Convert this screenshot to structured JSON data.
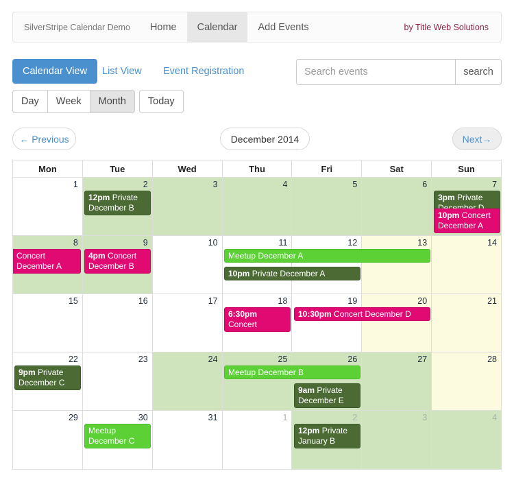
{
  "navbar": {
    "brand": "SilverStripe Calendar Demo",
    "links": [
      {
        "label": "Home",
        "active": false
      },
      {
        "label": "Calendar",
        "active": true
      },
      {
        "label": "Add Events",
        "active": false
      }
    ],
    "credit": "by Title Web Solutions"
  },
  "views": {
    "primary": "Calendar View",
    "list_view": "List View",
    "event_registration": "Event Registration"
  },
  "search": {
    "placeholder": "Search events",
    "value": "",
    "button": "search"
  },
  "ranges": [
    {
      "label": "Day",
      "active": false
    },
    {
      "label": "Week",
      "active": false
    },
    {
      "label": "Month",
      "active": true
    },
    {
      "label": "Today",
      "active": false
    }
  ],
  "pager": {
    "previous": "← Previous",
    "title": "December 2014",
    "next": "Next→"
  },
  "colors": {
    "private": "#4c6b34",
    "concert": "#e00a72",
    "meetup": "#5bd136",
    "accent": "#4a90cf",
    "tint_green": "#cfe4bd",
    "tint_cream": "#fcfadf",
    "brand_credit": "#8d2241"
  },
  "calendar": {
    "weekdays": [
      "Mon",
      "Tue",
      "Wed",
      "Thu",
      "Fri",
      "Sat",
      "Sun"
    ],
    "weeks": [
      {
        "days": [
          {
            "num": "1",
            "tint": "none",
            "other": false
          },
          {
            "num": "2",
            "tint": "green",
            "other": false
          },
          {
            "num": "3",
            "tint": "green",
            "other": false
          },
          {
            "num": "4",
            "tint": "green",
            "other": false
          },
          {
            "num": "5",
            "tint": "green",
            "other": false
          },
          {
            "num": "6",
            "tint": "green",
            "other": false
          },
          {
            "num": "7",
            "tint": "green",
            "other": false
          }
        ],
        "events": [
          {
            "time": "12pm",
            "title": "Private December B",
            "kind": "private",
            "col": 1,
            "span": 1,
            "row": 0,
            "lines": 2
          },
          {
            "time": "3pm",
            "title": "Private December D",
            "kind": "private",
            "col": 6,
            "span": 1,
            "row": 0,
            "lines": 2
          },
          {
            "time": "10pm",
            "title": "Concert December A",
            "kind": "concert",
            "col": 6,
            "span": 1,
            "row": 1,
            "lines": 2
          }
        ]
      },
      {
        "days": [
          {
            "num": "8",
            "tint": "green",
            "other": false
          },
          {
            "num": "9",
            "tint": "green",
            "other": false
          },
          {
            "num": "10",
            "tint": "none",
            "other": false
          },
          {
            "num": "11",
            "tint": "none",
            "other": false
          },
          {
            "num": "12",
            "tint": "none",
            "other": false
          },
          {
            "num": "13",
            "tint": "cream",
            "other": false
          },
          {
            "num": "14",
            "tint": "cream",
            "other": false
          }
        ],
        "events": [
          {
            "time": "",
            "title": "Concert December A",
            "kind": "concert",
            "col": 0,
            "span": 1,
            "row": 0,
            "lines": 2,
            "bleed": "left"
          },
          {
            "time": "4pm",
            "title": "Concert December B",
            "kind": "concert",
            "col": 1,
            "span": 1,
            "row": 0,
            "lines": 2
          },
          {
            "time": "",
            "title": "Meetup December A",
            "kind": "meetup",
            "col": 3,
            "span": 3,
            "row": 0,
            "lines": 1
          },
          {
            "time": "10pm",
            "title": "Private December A",
            "kind": "private",
            "col": 3,
            "span": 2,
            "row": 1,
            "lines": 1
          }
        ]
      },
      {
        "days": [
          {
            "num": "15",
            "tint": "none",
            "other": false
          },
          {
            "num": "16",
            "tint": "none",
            "other": false
          },
          {
            "num": "17",
            "tint": "none",
            "other": false
          },
          {
            "num": "18",
            "tint": "none",
            "other": false
          },
          {
            "num": "19",
            "tint": "none",
            "other": false
          },
          {
            "num": "20",
            "tint": "cream",
            "other": false
          },
          {
            "num": "21",
            "tint": "cream",
            "other": false
          }
        ],
        "events": [
          {
            "time": "6:30pm",
            "title": "Concert December C",
            "kind": "concert",
            "col": 3,
            "span": 1,
            "row": 0,
            "lines": 2
          },
          {
            "time": "10:30pm",
            "title": "Concert December D",
            "kind": "concert",
            "col": 4,
            "span": 2,
            "row": 0,
            "lines": 1
          }
        ]
      },
      {
        "days": [
          {
            "num": "22",
            "tint": "none",
            "other": false
          },
          {
            "num": "23",
            "tint": "none",
            "other": false
          },
          {
            "num": "24",
            "tint": "green",
            "other": false
          },
          {
            "num": "25",
            "tint": "green",
            "other": false
          },
          {
            "num": "26",
            "tint": "green",
            "other": false
          },
          {
            "num": "27",
            "tint": "green",
            "other": false
          },
          {
            "num": "28",
            "tint": "cream",
            "other": false
          }
        ],
        "events": [
          {
            "time": "9pm",
            "title": "Private December C",
            "kind": "private",
            "col": 0,
            "span": 1,
            "row": 0,
            "lines": 2
          },
          {
            "time": "",
            "title": "Meetup December B",
            "kind": "meetup",
            "col": 3,
            "span": 2,
            "row": 0,
            "lines": 1
          },
          {
            "time": "9am",
            "title": "Private December E",
            "kind": "private",
            "col": 4,
            "span": 1,
            "row": 1,
            "lines": 2
          }
        ]
      },
      {
        "days": [
          {
            "num": "29",
            "tint": "none",
            "other": false
          },
          {
            "num": "30",
            "tint": "none",
            "other": false
          },
          {
            "num": "31",
            "tint": "none",
            "other": false
          },
          {
            "num": "1",
            "tint": "none",
            "other": true
          },
          {
            "num": "2",
            "tint": "green",
            "other": true
          },
          {
            "num": "3",
            "tint": "green",
            "other": true
          },
          {
            "num": "4",
            "tint": "green",
            "other": true
          }
        ],
        "events": [
          {
            "time": "",
            "title": "Meetup December C",
            "kind": "meetup",
            "col": 1,
            "span": 1,
            "row": 0,
            "lines": 2
          },
          {
            "time": "12pm",
            "title": "Private January B",
            "kind": "private",
            "col": 4,
            "span": 1,
            "row": 0,
            "lines": 2
          }
        ]
      }
    ]
  }
}
